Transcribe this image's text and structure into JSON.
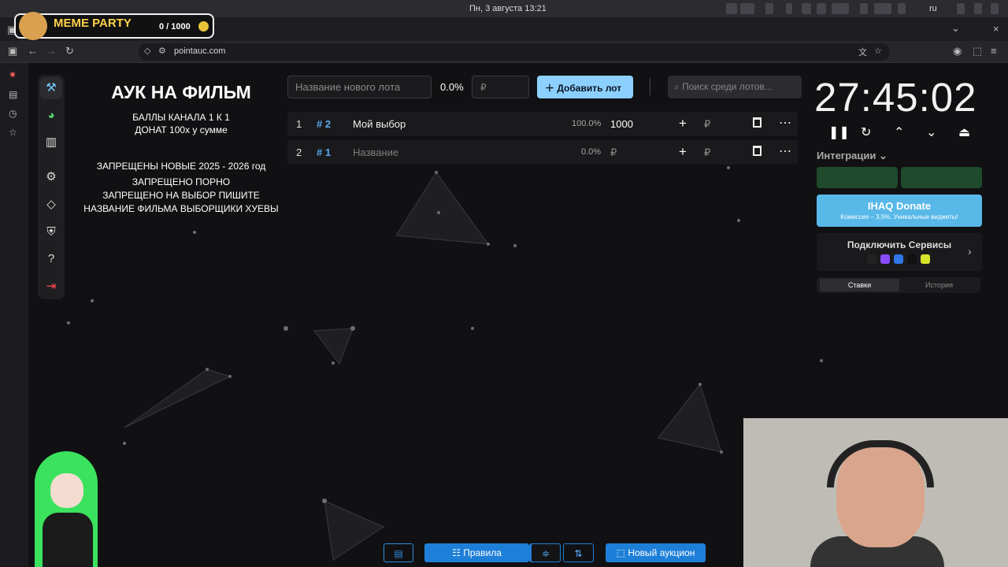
{
  "os": {
    "clock": "Пн, 3 августа  13:21",
    "lang": "ru"
  },
  "browser": {
    "url": "pointauc.com"
  },
  "overlay": {
    "title": "MEME PARTY",
    "counter": "0 / 1000"
  },
  "info": {
    "title": "АУК НА ФИЛЬМ",
    "lines": [
      "БАЛЛЫ КАНАЛА 1 К 1",
      "ДОНАТ 100х у сумме",
      "",
      "ЗАПРЕЩЕНЫ НОВЫЕ 2025 - 2026 год",
      "ЗАПРЕЩЕНО ПОРНО",
      "ЗАПРЕЩЕНО НА ВЫБОР ПИШИТЕ",
      "НАЗВАНИЕ ФИЛЬМА ВЫБОРЩИКИ ХУЕВЫ"
    ]
  },
  "toolbar": {
    "new_lot_placeholder": "Название нового лота",
    "percent": "0.0%",
    "currency_placeholder": "₽",
    "add_button": "Добавить лот",
    "search_placeholder": "Поиск среди лотов..."
  },
  "lots": [
    {
      "index": "1",
      "tag": "# 2",
      "name": "Мой выбор",
      "percent": "100.0%",
      "amount": "1000",
      "currency": "₽"
    },
    {
      "index": "2",
      "tag": "# 1",
      "name": "Название",
      "percent": "0.0%",
      "amount": "₽",
      "currency": "₽"
    }
  ],
  "timer": "27:45:02",
  "integrations": {
    "label": "Интеграции",
    "ihaq_title": "IHAQ Donate",
    "ihaq_subtitle": "Комиссия – 3,5%. Уникальные виджеты!",
    "connect_services": "Подключить Сервисы"
  },
  "history_tabs": [
    "Ставки",
    "История"
  ],
  "bottom": {
    "rules": "Правила",
    "new_auction": "Новый аукцион"
  }
}
